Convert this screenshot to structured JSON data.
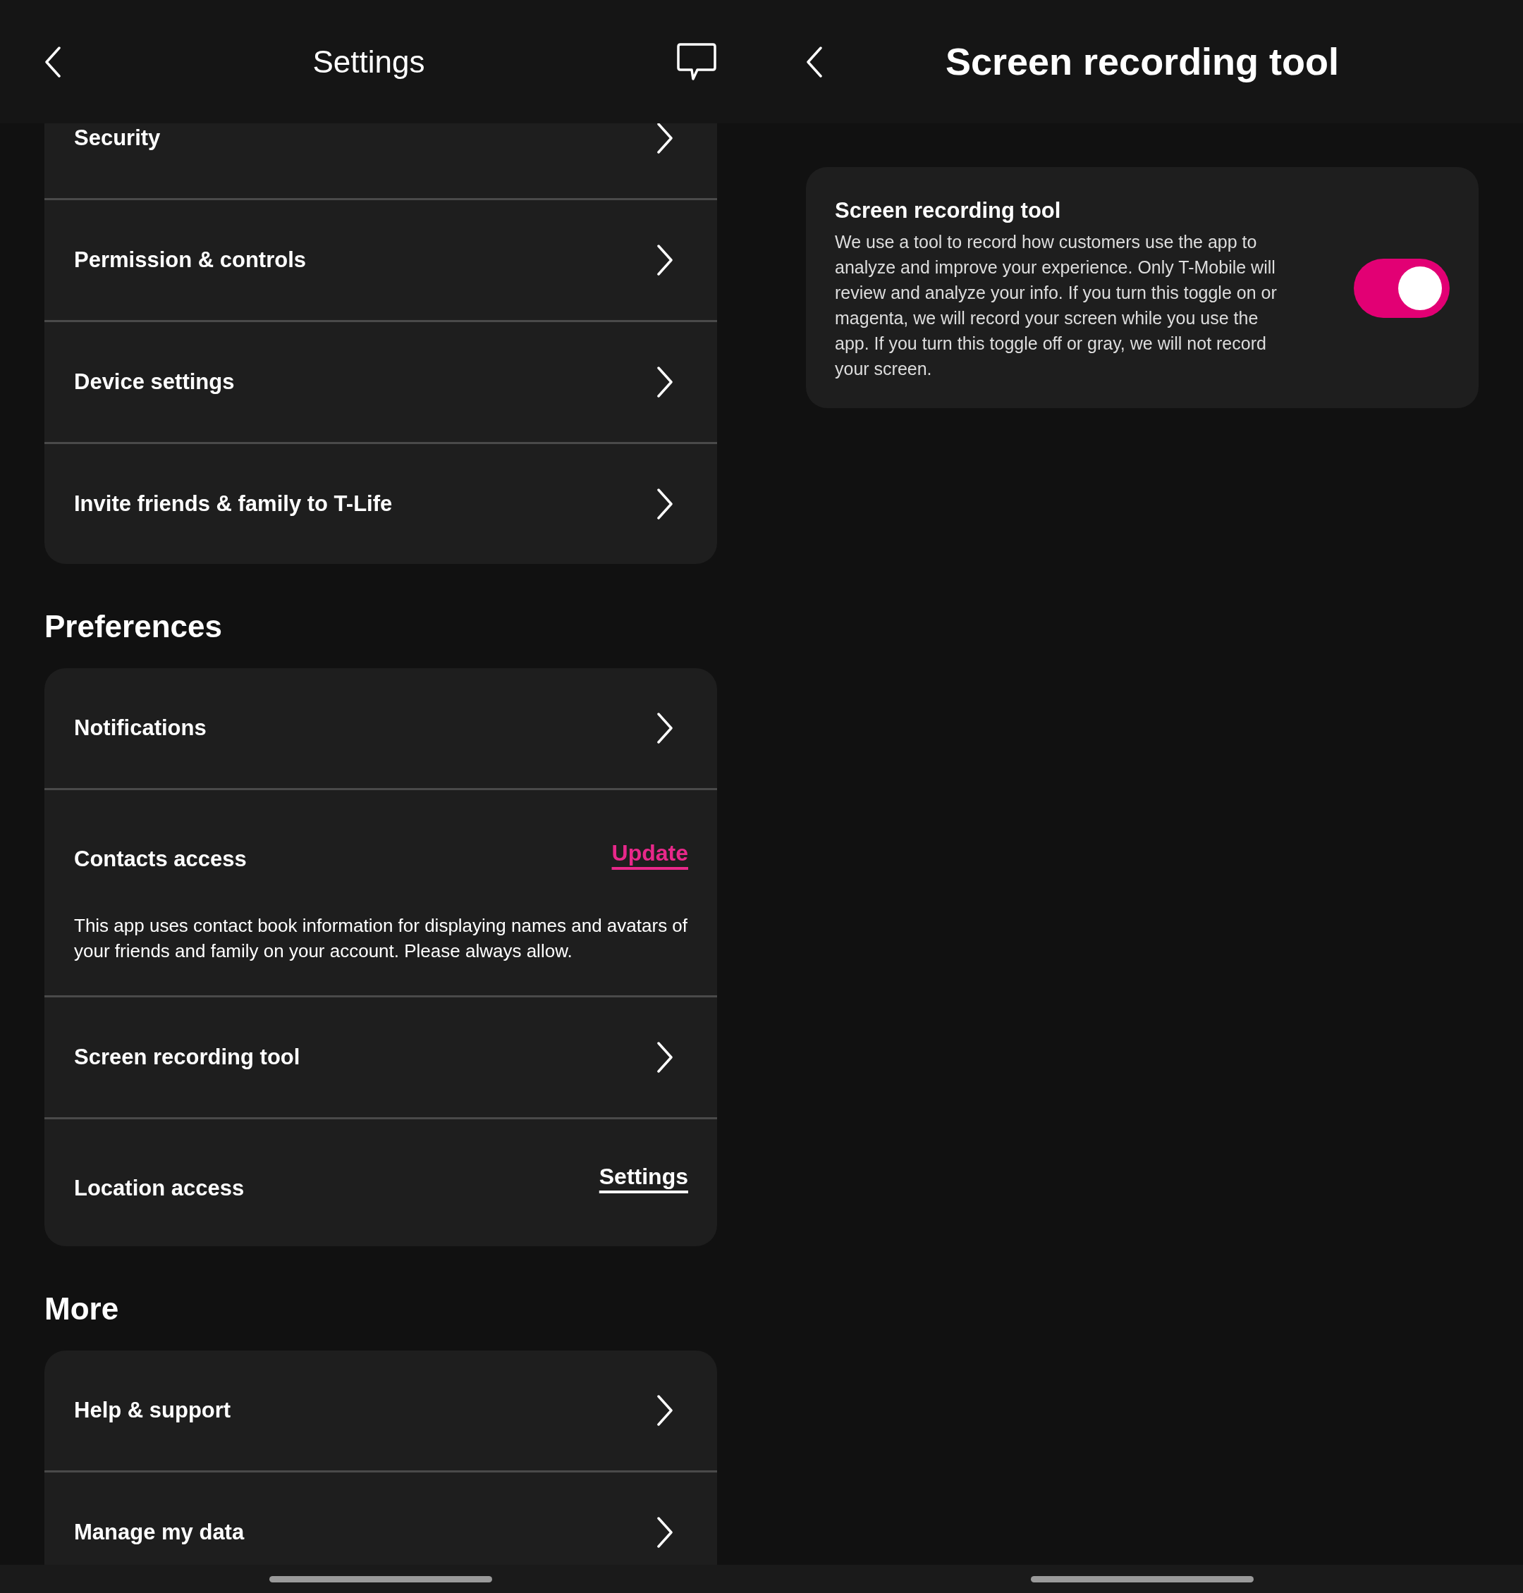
{
  "settings_screen": {
    "header": {
      "title": "Settings"
    },
    "sections": [
      {
        "rows": [
          {
            "kind": "nav",
            "label": "Security"
          },
          {
            "kind": "nav",
            "label": "Permission & controls"
          },
          {
            "kind": "nav",
            "label": "Device settings"
          },
          {
            "kind": "nav",
            "label": "Invite friends & family to T-Life"
          }
        ]
      },
      {
        "heading": "Preferences",
        "rows": [
          {
            "kind": "nav",
            "label": "Notifications"
          },
          {
            "kind": "link",
            "label": "Contacts access",
            "link": {
              "text": "Update",
              "color": "#e8288a"
            },
            "description": "This app uses contact book information for displaying names and avatars of your friends and family on your account. Please always allow."
          },
          {
            "kind": "nav",
            "label": "Screen recording tool"
          },
          {
            "kind": "link",
            "label": "Location access",
            "link": {
              "text": "Settings",
              "color": "#ffffff"
            }
          }
        ]
      },
      {
        "heading": "More",
        "rows": [
          {
            "kind": "nav",
            "label": "Help & support"
          },
          {
            "kind": "nav",
            "label": "Manage my data"
          }
        ]
      }
    ]
  },
  "screen_recording_screen": {
    "header": {
      "title": "Screen recording tool"
    },
    "card": {
      "title": "Screen recording tool",
      "description": "We use a tool to record how customers use the app to analyze and improve your experience. Only T-Mobile will review and analyze your info. If you turn this toggle on or magenta, we will record your screen while you use the app. If you turn this toggle off or gray, we will not record your screen.",
      "toggle": {
        "on": true
      }
    }
  }
}
